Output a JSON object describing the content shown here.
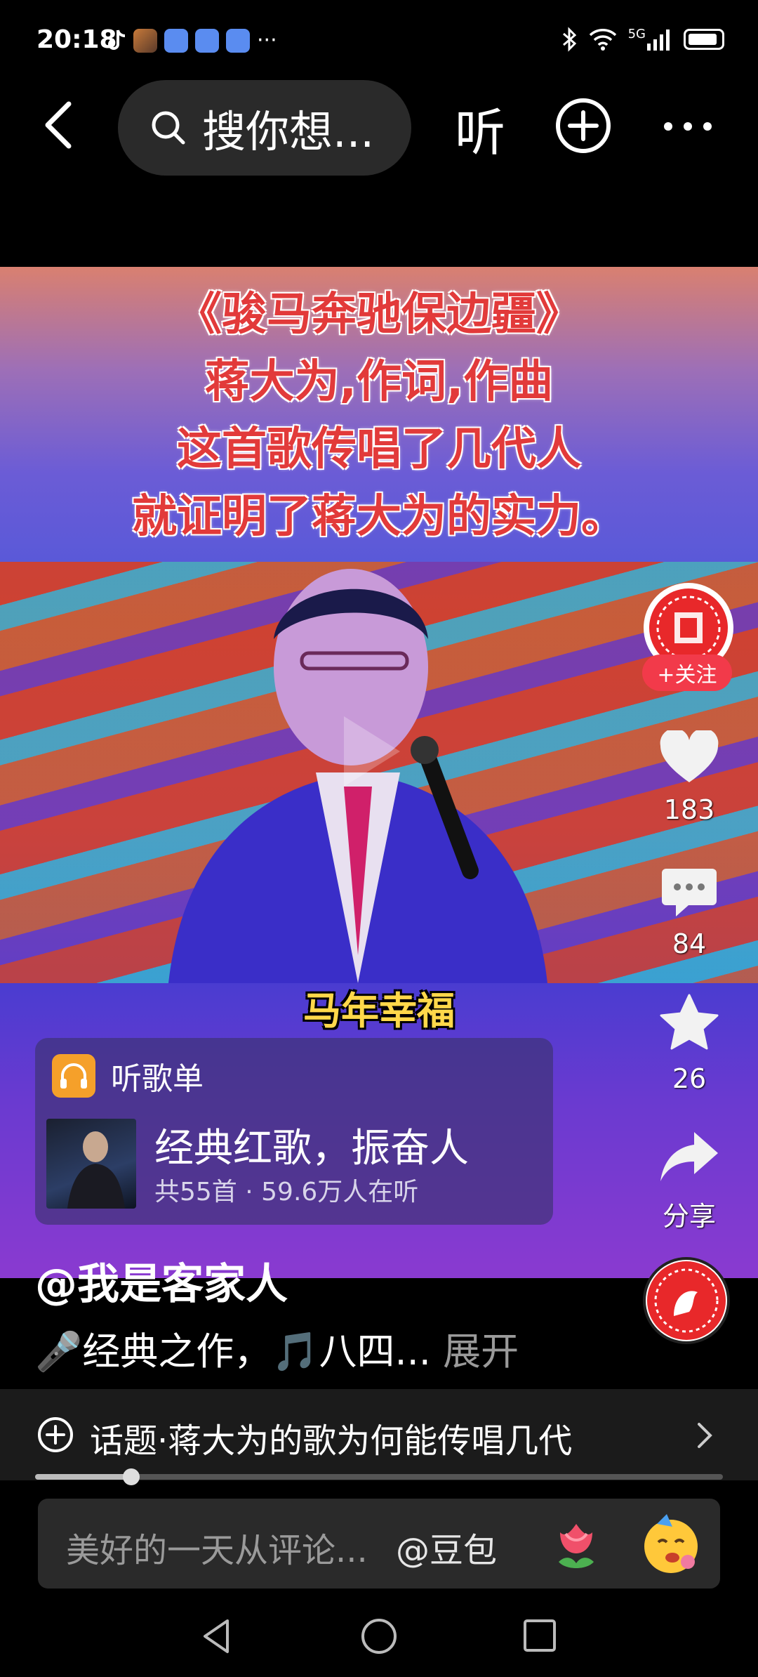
{
  "status_bar": {
    "time": "20:18",
    "overflow": "···",
    "network": "5G"
  },
  "top_nav": {
    "search_placeholder": "搜你想...",
    "listen_label": "听"
  },
  "video": {
    "overlay_lines": [
      "《骏马奔驰保边疆》",
      "蒋大为,作词,作曲",
      "这首歌传唱了几代人",
      "就证明了蒋大为的实力。"
    ],
    "subtitle": "马年幸福"
  },
  "actions": {
    "follow_label": "+关注",
    "like_count": "183",
    "comment_count": "84",
    "favorite_count": "26",
    "share_label": "分享"
  },
  "playlist": {
    "header": "听歌单",
    "title": "经典红歌，振奋人",
    "meta": "共55首 · 59.6万人在听"
  },
  "post": {
    "username": "@我是客家人",
    "caption": "🎤经典之作，🎵八四...",
    "expand_label": "展开"
  },
  "topic": {
    "text": "话题·蒋大为的歌为何能传唱几代",
    "progress": 0.14
  },
  "comment_bar": {
    "placeholder": "美好的一天从评论...",
    "mention": "@豆包"
  },
  "colors": {
    "follow": "#f23a4a",
    "overlay_text": "#e23a3a",
    "subtitle": "#ffd84a",
    "playlist_icon": "#f5a02a"
  },
  "icons": [
    "back-icon",
    "search-icon",
    "add-circle-icon",
    "more-icon",
    "heart-icon",
    "comment-icon",
    "star-icon",
    "share-icon",
    "headphones-icon",
    "chevron-right-icon",
    "flower-icon",
    "emoji-icon"
  ]
}
